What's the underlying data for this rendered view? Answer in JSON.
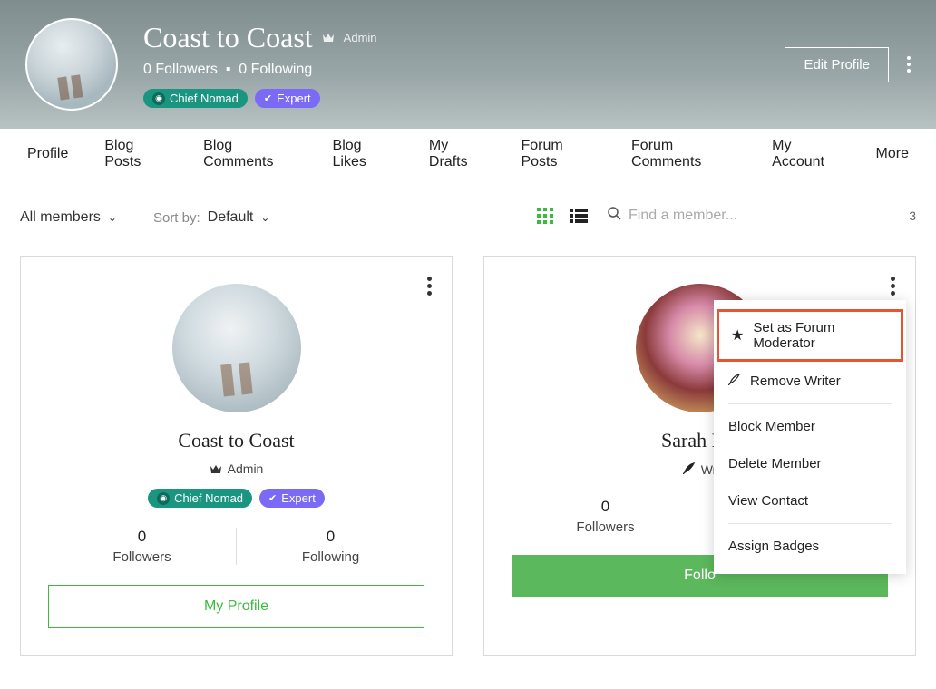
{
  "header": {
    "title": "Coast to Coast",
    "role": "Admin",
    "followers_count": "0",
    "followers_label": "Followers",
    "following_count": "0",
    "following_label": "Following",
    "badges": {
      "nomad": "Chief Nomad",
      "expert": "Expert"
    },
    "edit_profile": "Edit Profile"
  },
  "tabs": {
    "profile": "Profile",
    "blog_posts": "Blog Posts",
    "blog_comments": "Blog Comments",
    "blog_likes": "Blog Likes",
    "my_drafts": "My Drafts",
    "forum_posts": "Forum Posts",
    "forum_comments": "Forum Comments",
    "my_account": "My Account",
    "more": "More"
  },
  "controls": {
    "filter": "All members",
    "sortby_label": "Sort by:",
    "sortby_value": "Default",
    "search_placeholder": "Find a member...",
    "result_count": "3"
  },
  "cards": [
    {
      "name": "Coast to Coast",
      "role": "Admin",
      "badges": {
        "nomad": "Chief Nomad",
        "expert": "Expert"
      },
      "followers_num": "0",
      "followers_label": "Followers",
      "following_num": "0",
      "following_label": "Following",
      "button": "My Profile"
    },
    {
      "name": "Sarah Fre",
      "role": "Wr",
      "followers_num": "0",
      "followers_label": "Followers",
      "button": "Follo"
    }
  ],
  "menu": {
    "set_moderator": "Set as Forum Moderator",
    "remove_writer": "Remove Writer",
    "block_member": "Block Member",
    "delete_member": "Delete Member",
    "view_contact": "View Contact",
    "assign_badges": "Assign Badges"
  }
}
